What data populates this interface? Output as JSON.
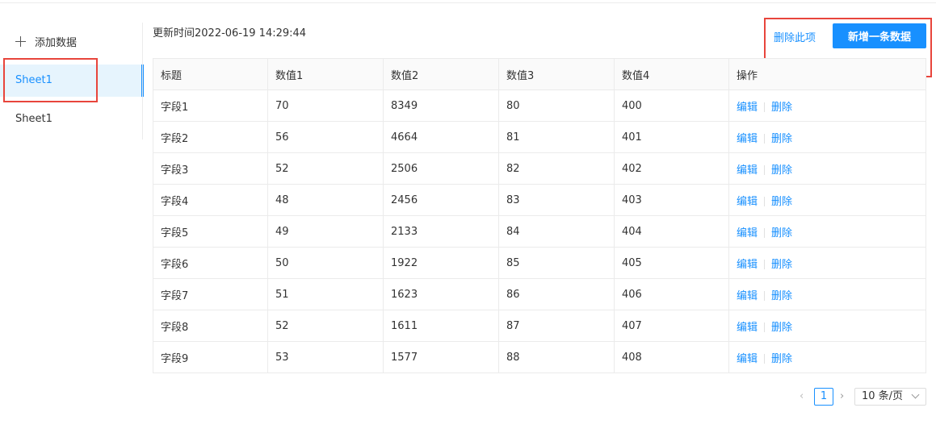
{
  "sidebar": {
    "add_label": "添加数据",
    "sheets": [
      {
        "label": "Sheet1",
        "active": true
      },
      {
        "label": "Sheet1",
        "active": false
      }
    ]
  },
  "header": {
    "update_time": "更新时间2022-06-19 14:29:44",
    "delete_label": "删除此项",
    "add_label": "新增一条数据"
  },
  "table": {
    "columns": [
      "标题",
      "数值1",
      "数值2",
      "数值3",
      "数值4",
      "操作"
    ],
    "rows": [
      [
        "字段1",
        "70",
        "8349",
        "80",
        "400"
      ],
      [
        "字段2",
        "56",
        "4664",
        "81",
        "401"
      ],
      [
        "字段3",
        "52",
        "2506",
        "82",
        "402"
      ],
      [
        "字段4",
        "48",
        "2456",
        "83",
        "403"
      ],
      [
        "字段5",
        "49",
        "2133",
        "84",
        "404"
      ],
      [
        "字段6",
        "50",
        "1922",
        "85",
        "405"
      ],
      [
        "字段7",
        "51",
        "1623",
        "86",
        "406"
      ],
      [
        "字段8",
        "52",
        "1611",
        "87",
        "407"
      ],
      [
        "字段9",
        "53",
        "1577",
        "88",
        "408"
      ]
    ],
    "edit_label": "编辑",
    "remove_label": "删除"
  },
  "pager": {
    "prev": "‹",
    "current": "1",
    "next": "›",
    "page_size": "10 条/页"
  },
  "colors": {
    "accent": "#1890ff",
    "highlight_box": "#e8453c"
  }
}
